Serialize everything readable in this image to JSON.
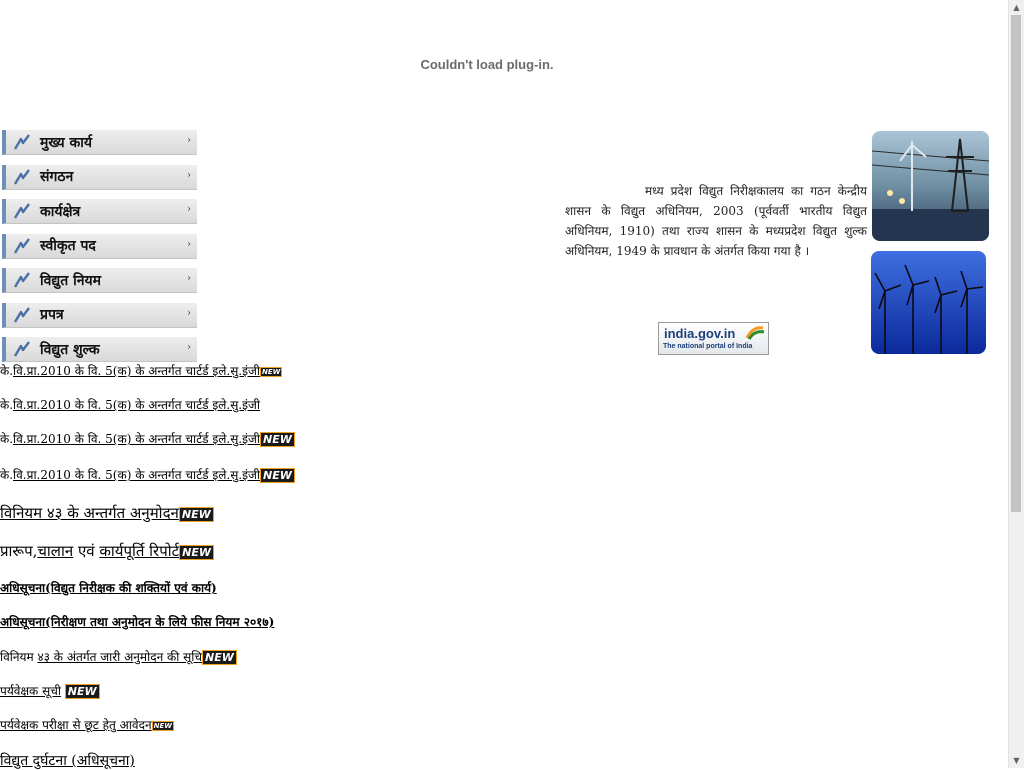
{
  "plugin_message": "Couldn't load plug-in.",
  "menu": [
    {
      "label": "मुख्य कार्य",
      "arrow": "›"
    },
    {
      "label": "संगठन",
      "arrow": "›"
    },
    {
      "label": "कार्यक्षेत्र",
      "arrow": "›"
    },
    {
      "label": "स्वीकृत पद",
      "arrow": "›"
    },
    {
      "label": "विद्युत नियम",
      "arrow": "›"
    },
    {
      "label": "प्रपत्र",
      "arrow": "›"
    },
    {
      "label": "विद्युत शुल्क",
      "arrow": "›"
    }
  ],
  "links": [
    {
      "prefix": "के.",
      "text": "वि.प्रा.2010 के वि. 5(क) के अन्तर्गत चार्टर्ड इले.सु.इंजी",
      "suffix": "",
      "badge": "NEW"
    },
    {
      "prefix": "के.",
      "text": "वि.प्रा.2010 के वि. 5(क) के अन्तर्गत चार्टर्ड इले.सु.इंजी",
      "suffix": "",
      "badge": ""
    },
    {
      "prefix": "के.",
      "text": "वि.प्रा.2010 के वि. 5(क) के अन्तर्गत चार्टर्ड इले.सु.इंजी",
      "suffix": "",
      "badge": "NEW"
    },
    {
      "prefix": "के.",
      "text": "वि.प्रा.2010 के वि. 5(क) के अन्तर्गत चार्टर्ड इले.सु.इंजी",
      "suffix": "",
      "badge": "NEW"
    },
    {
      "prefix": "",
      "text": "विनियम ४३ के अन्तर्गत अनुमोदन",
      "suffix": "",
      "badge": "NEW"
    },
    {
      "prefix": "प्रारूप,",
      "text": "चालान",
      "suffix": " एवं ",
      "text2": "कार्यपूर्ति रिपोर्ट",
      "badge": "NEW"
    },
    {
      "prefix": "",
      "text": "अधिसूचना(विद्युत निरीक्षक की शक्तियों एवं कार्य)",
      "suffix": "",
      "badge": ""
    },
    {
      "prefix": "",
      "text": "अधिसूचना(निरीक्षण तथा अनुमोदन के लिये फीस नियम २०१७)",
      "suffix": "",
      "badge": ""
    },
    {
      "prefix": "विनियम ",
      "text": "४३ के अंतर्गत जारी अनुमोदन की सूचि",
      "suffix": "",
      "badge": "NEW"
    },
    {
      "prefix": "",
      "text": "पर्यवेक्षक सूची",
      "suffix": " ",
      "badge": "NEW"
    },
    {
      "prefix": "",
      "text": "पर्यवेक्षक परीक्षा से छूट हेतु आवेदन",
      "suffix": "",
      "badge": "NEW"
    },
    {
      "prefix": "",
      "text": "विद्युत दुर्घटना (अधिसूचना)",
      "suffix": "",
      "badge": ""
    }
  ],
  "intro_text": "मध्य प्रदेश विद्युत निरीक्षकालय का गठन केन्द्रीय शासन के विद्युत अधिनियम, 2003 (पूर्ववर्ती भारतीय विद्युत अधिनियम, 1910) तथा राज्य शासन के मध्यप्रदेश विद्युत शुल्क अधिनियम, 1949 के प्रावधान के अंतर्गत किया गया है ।",
  "india_portal": {
    "title": "india.gov.in",
    "subtitle": "The national portal of India"
  },
  "colors": {
    "menu_border": "#6f8fb8",
    "badge_outline": "#f0a020",
    "portal_blue": "#1d3f7a"
  }
}
